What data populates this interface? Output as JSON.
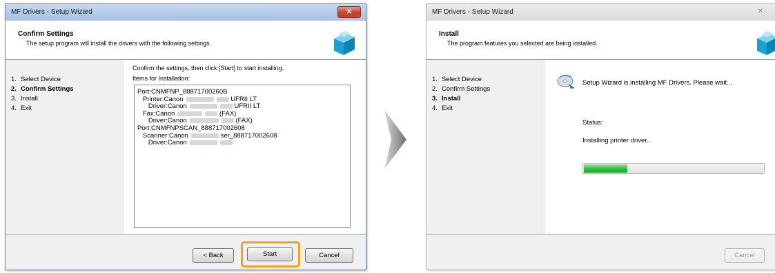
{
  "window1": {
    "title": "MF Drivers - Setup Wizard",
    "close_label": "✕",
    "header": {
      "title": "Confirm Settings",
      "subtitle": "The setup program will install the drivers with the following settings."
    },
    "steps": [
      {
        "num": "1.",
        "label": "Select Device"
      },
      {
        "num": "2.",
        "label": "Confirm Settings"
      },
      {
        "num": "3.",
        "label": "Install"
      },
      {
        "num": "4.",
        "label": "Exit"
      }
    ],
    "active_step": 1,
    "instruction": "Confirm the settings, then click [Start] to start installing.",
    "items_label": "Items for Installation:",
    "items": {
      "port1": "Port:CNMFNP_88871700260B",
      "printer_prefix": "Printer:Canon",
      "printer_suffix": "UFRII LT",
      "driver1_prefix": "Driver:Canon",
      "driver1_suffix": "UFRII LT",
      "fax_prefix": "Fax:Canon",
      "fax_suffix": "(FAX)",
      "driver2_prefix": "Driver:Canon",
      "driver2_suffix": "(FAX)",
      "port2": "Port:CNMFNPSCAN_888717002608",
      "scanner_prefix": "Scanner:Canon",
      "scanner_suffix": "ser_888717002608",
      "driver3_prefix": "Driver:Canon"
    },
    "buttons": {
      "back": "< Back",
      "start": "Start",
      "cancel": "Cancel"
    }
  },
  "window2": {
    "title": "MF Drivers - Setup Wizard",
    "close_label": "✕",
    "header": {
      "title": "Install",
      "subtitle": "The program features you selected are being installed."
    },
    "steps": [
      {
        "num": "1.",
        "label": "Select Device"
      },
      {
        "num": "2.",
        "label": "Confirm Settings"
      },
      {
        "num": "3.",
        "label": "Install"
      },
      {
        "num": "4.",
        "label": "Exit"
      }
    ],
    "active_step": 2,
    "message": "Setup Wizard is installing MF Drivers. Please wait...",
    "status_label": "Status:",
    "status_text": "Installing printer driver...",
    "progress_percent": 24,
    "buttons": {
      "cancel": "Cancel"
    }
  },
  "colors": {
    "highlight": "#f0a21f",
    "progress_fill": "#2fbf3c"
  }
}
